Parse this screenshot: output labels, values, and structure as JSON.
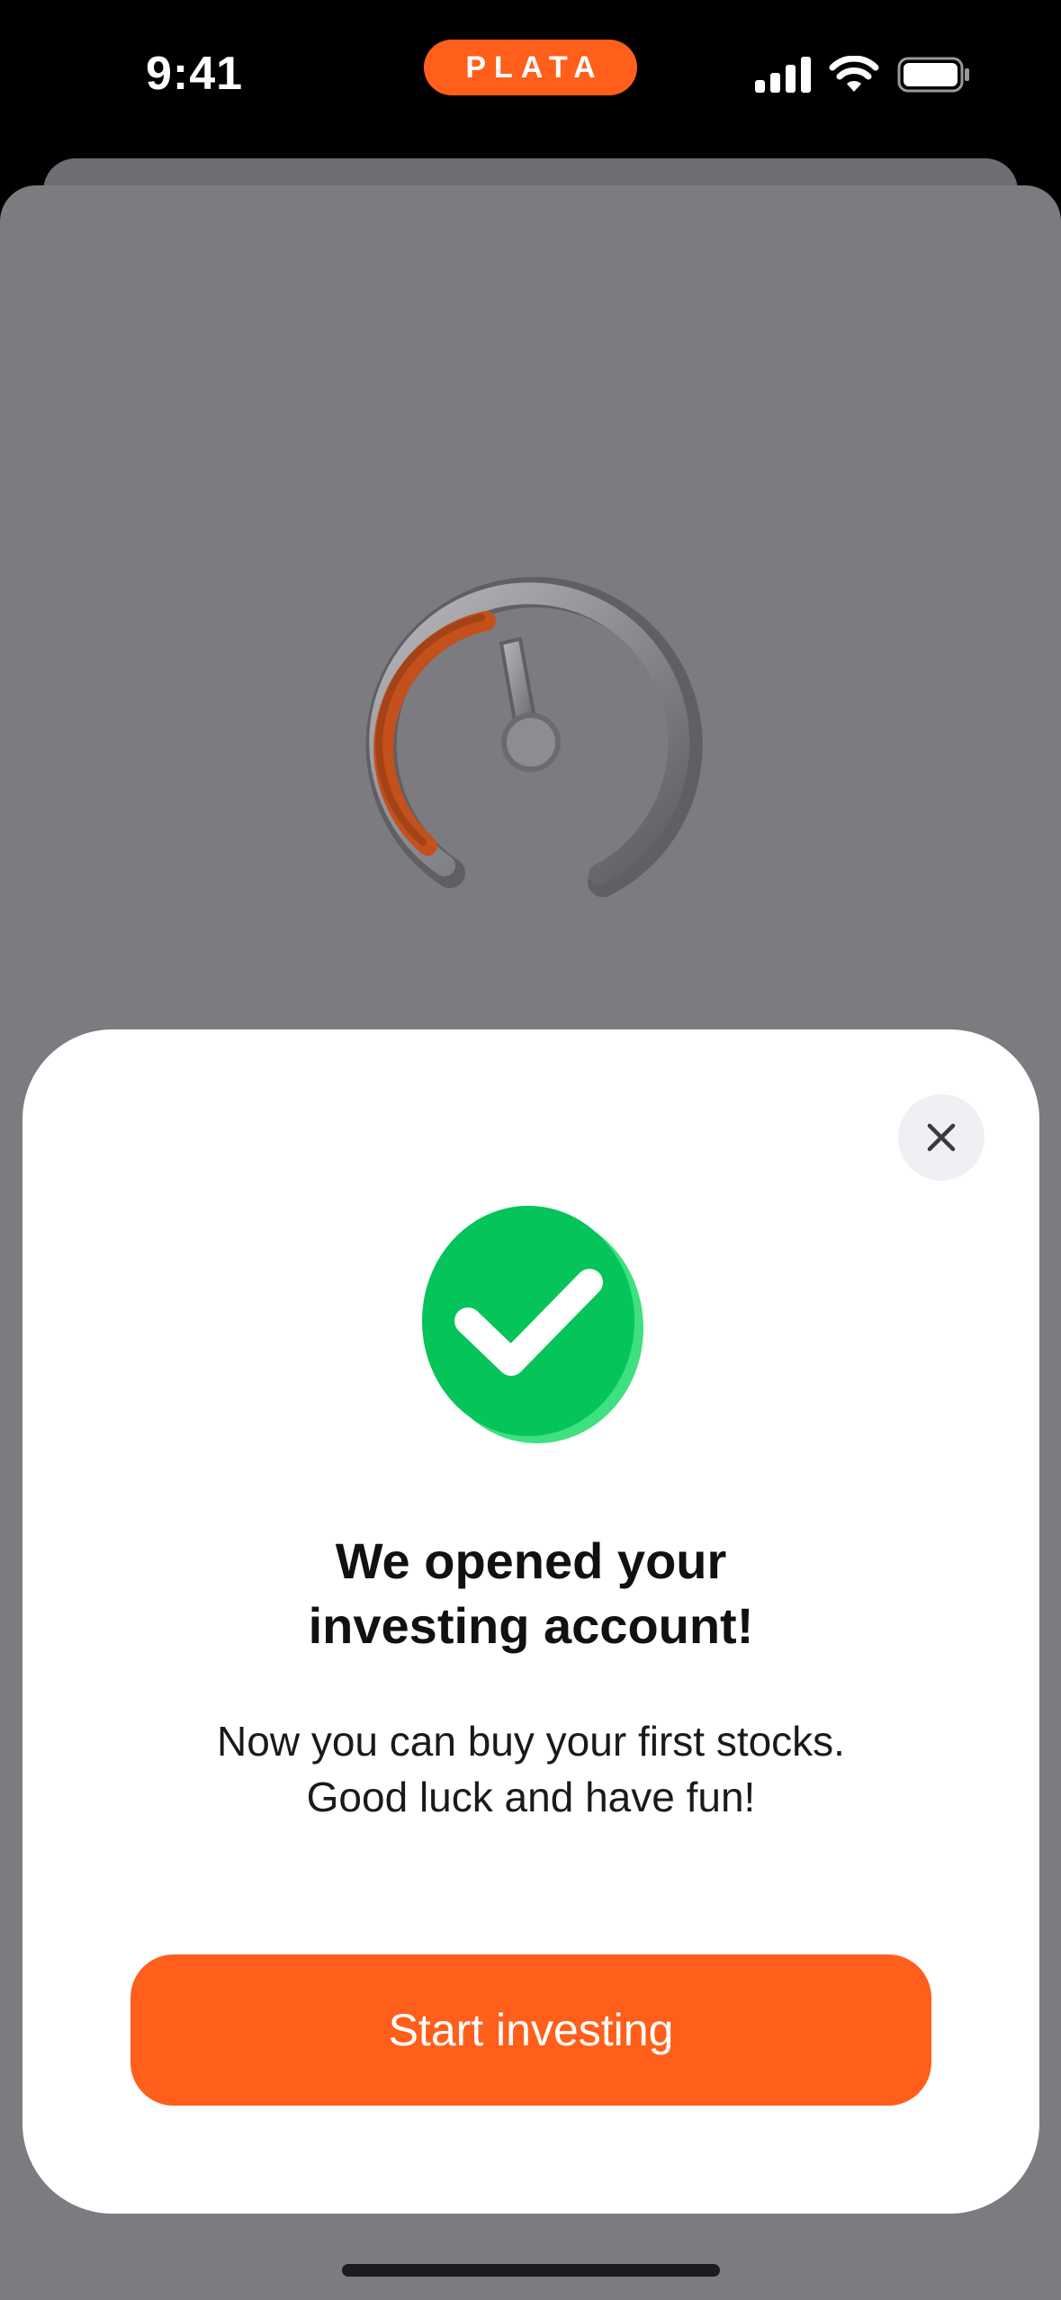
{
  "status_bar": {
    "time": "9:41",
    "brand": "PLATA",
    "icons": [
      "cellular-signal-icon",
      "wifi-icon",
      "battery-icon"
    ]
  },
  "background": {
    "illustration": "speedometer-gauge-icon"
  },
  "modal": {
    "badge_icon": "success-checkmark-icon",
    "title_line1": "We opened your",
    "title_line2": "investing account!",
    "subtitle_line1": "Now you can buy your first stocks.",
    "subtitle_line2": "Good luck and have fun!",
    "cta_label": "Start investing",
    "close_icon": "close-icon"
  },
  "colors": {
    "brand_orange": "#ff5f1a",
    "success_green": "#05c45a",
    "overlay_gray": "#7b7b80"
  }
}
